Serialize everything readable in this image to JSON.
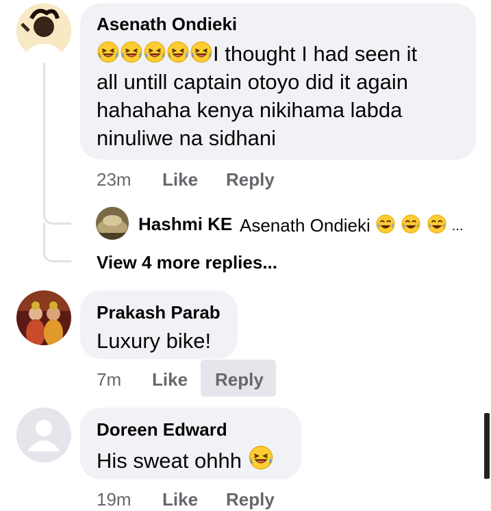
{
  "comments": [
    {
      "author": "Asenath Ondieki",
      "emoji_prefix": [
        "laughing-emoji",
        "laughing-emoji",
        "laughing-emoji",
        "laughing-emoji",
        "laughing-emoji"
      ],
      "text_line1": "I thought  I had seen it",
      "text_line2": "all untill captain otoyo did it again",
      "text_line3": "hahahaha kenya nikihama labda",
      "text_line4": "ninuliwe na sidhani",
      "time": "23m",
      "like_label": "Like",
      "reply_label": "Reply"
    },
    {
      "author": "Prakash Parab",
      "text": "Luxury bike!",
      "time": "7m",
      "like_label": "Like",
      "reply_label": "Reply"
    },
    {
      "author": "Doreen Edward",
      "text": "His sweat ohhh",
      "emoji_suffix": "laughing-emoji",
      "time": "19m",
      "like_label": "Like",
      "reply_label": "Reply"
    }
  ],
  "reply_preview": {
    "author": "Hashmi KE",
    "text": "Asenath Ondieki",
    "emojis": [
      "joy-emoji",
      "joy-emoji",
      "joy-emoji"
    ],
    "ellipsis": "..."
  },
  "view_more": "View 4 more replies...",
  "colors": {
    "bubble": "#f0f2f5",
    "secondary_text": "#65676b",
    "primary_text": "#050505",
    "emoji_yellow": "#ffcc33",
    "emoji_tear": "#4a90e2",
    "reply_highlight": "#e4e6eb"
  }
}
